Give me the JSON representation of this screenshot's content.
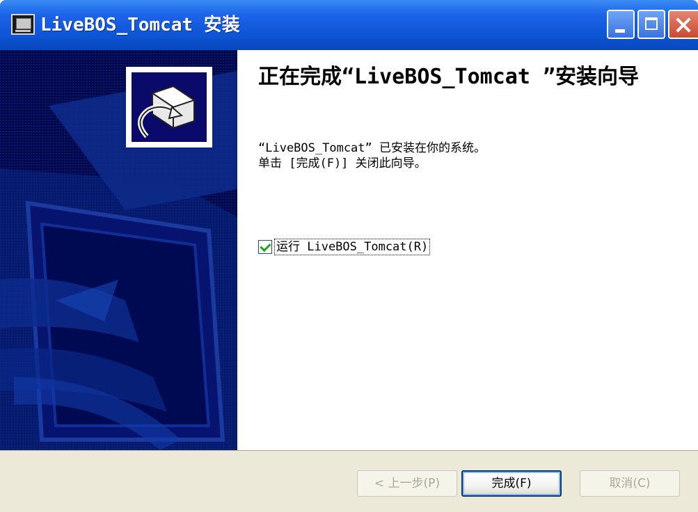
{
  "window": {
    "title": "LiveBOS_Tomcat 安装"
  },
  "content": {
    "heading": "正在完成“LiveBOS_Tomcat ”安装向导",
    "description_line1": "“LiveBOS_Tomcat” 已安装在你的系统。",
    "description_line2": "单击 [完成(F)] 关闭此向导。",
    "run_checkbox_label": "运行 LiveBOS_Tomcat(R)",
    "run_checkbox_checked": true
  },
  "footer": {
    "back_label": "< 上一步(P)",
    "finish_label": "完成(F)",
    "cancel_label": "取消(C)"
  },
  "colors": {
    "titlebar": "#0e55d6",
    "side_panel": "#00084a",
    "footer_bg": "#ece9d8",
    "checkmark": "#21a121"
  },
  "icons": {
    "title": "setup-app-icon",
    "logo": "computer-setup-icon"
  }
}
